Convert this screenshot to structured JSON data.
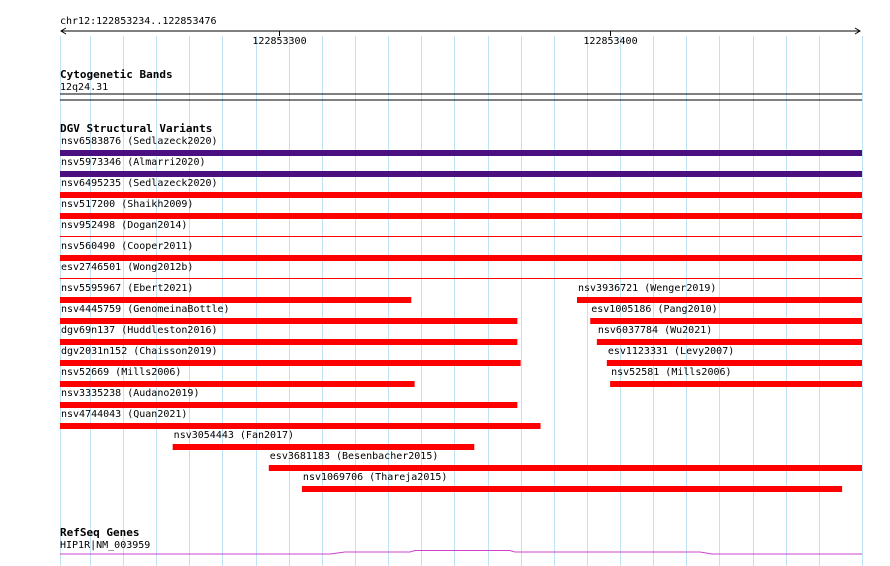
{
  "region": {
    "label": "chr12:122853234..122853476",
    "start": 122853234,
    "end": 122853476
  },
  "ruler": {
    "major_ticks": [
      {
        "pos": 122853300,
        "label": "122853300"
      },
      {
        "pos": 122853400,
        "label": "122853400"
      }
    ],
    "grid_positions": [
      122853234,
      122853243,
      122853253,
      122853263,
      122853273,
      122853283,
      122853293,
      122853303,
      122853313,
      122853323,
      122853333,
      122853343,
      122853353,
      122853363,
      122853373,
      122853383,
      122853393,
      122853403,
      122853413,
      122853423,
      122853433,
      122853443,
      122853453,
      122853463,
      122853476
    ]
  },
  "tracks": {
    "cytoband": {
      "title": "Cytogenetic Bands",
      "band": "12q24.31"
    },
    "dgv": {
      "title": "DGV Structural Variants",
      "variants": [
        {
          "label": "nsv6583876 (Sedlazeck2020)",
          "start": 122853234,
          "end": 122853476,
          "row": 0,
          "type": "inversion",
          "color": "#4b0f7f"
        },
        {
          "label": "nsv5973346 (Almarri2020)",
          "start": 122853234,
          "end": 122853476,
          "row": 1,
          "type": "inversion",
          "color": "#4b0f7f"
        },
        {
          "label": "nsv6495235 (Sedlazeck2020)",
          "start": 122853234,
          "end": 122853476,
          "row": 2,
          "type": "loss",
          "color": "#ff0000"
        },
        {
          "label": "nsv517200 (Shaikh2009)",
          "start": 122853234,
          "end": 122853476,
          "row": 3,
          "type": "loss",
          "color": "#ff0000"
        },
        {
          "label": "nsv952498 (Dogan2014)",
          "start": 122853234,
          "end": 122853476,
          "row": 4,
          "type": "loss-thin",
          "color": "#ff0000"
        },
        {
          "label": "nsv560490 (Cooper2011)",
          "start": 122853234,
          "end": 122853476,
          "row": 5,
          "type": "loss",
          "color": "#ff0000"
        },
        {
          "label": "esv2746501 (Wong2012b)",
          "start": 122853234,
          "end": 122853476,
          "row": 6,
          "type": "loss-thin",
          "color": "#ff0000"
        },
        {
          "label": "nsv5595967 (Ebert2021)",
          "start": 122853234,
          "end": 122853340,
          "row": 7,
          "type": "loss",
          "color": "#ff0000"
        },
        {
          "label": "nsv3936721 (Wenger2019)",
          "start": 122853390,
          "end": 122853476,
          "row": 7,
          "type": "loss",
          "color": "#ff0000"
        },
        {
          "label": "nsv4445759 (GenomeinaBottle)",
          "start": 122853234,
          "end": 122853372,
          "row": 8,
          "type": "loss",
          "color": "#ff0000"
        },
        {
          "label": "esv1005186 (Pang2010)",
          "start": 122853394,
          "end": 122853476,
          "row": 8,
          "type": "loss",
          "color": "#ff0000"
        },
        {
          "label": "dgv69n137 (Huddleston2016)",
          "start": 122853234,
          "end": 122853372,
          "row": 9,
          "type": "loss",
          "color": "#ff0000"
        },
        {
          "label": "nsv6037784 (Wu2021)",
          "start": 122853396,
          "end": 122853476,
          "row": 9,
          "type": "loss",
          "color": "#ff0000"
        },
        {
          "label": "dgv2031n152 (Chaisson2019)",
          "start": 122853234,
          "end": 122853373,
          "row": 10,
          "type": "loss",
          "color": "#ff0000"
        },
        {
          "label": "esv1123331 (Levy2007)",
          "start": 122853399,
          "end": 122853476,
          "row": 10,
          "type": "loss",
          "color": "#ff0000"
        },
        {
          "label": "nsv52669 (Mills2006)",
          "start": 122853234,
          "end": 122853341,
          "row": 11,
          "type": "loss",
          "color": "#ff0000"
        },
        {
          "label": "nsv52581 (Mills2006)",
          "start": 122853400,
          "end": 122853476,
          "row": 11,
          "type": "loss",
          "color": "#ff0000"
        },
        {
          "label": "nsv3335238 (Audano2019)",
          "start": 122853234,
          "end": 122853372,
          "row": 12,
          "type": "loss",
          "color": "#ff0000"
        },
        {
          "label": "nsv4744043 (Quan2021)",
          "start": 122853234,
          "end": 122853379,
          "row": 13,
          "type": "loss",
          "color": "#ff0000"
        },
        {
          "label": "nsv3054443 (Fan2017)",
          "start": 122853268,
          "end": 122853359,
          "row": 14,
          "type": "loss",
          "color": "#ff0000"
        },
        {
          "label": "esv3681183 (Besenbacher2015)",
          "start": 122853297,
          "end": 122853476,
          "row": 15,
          "type": "loss",
          "color": "#ff0000"
        },
        {
          "label": "nsv1069706 (Thareja2015)",
          "start": 122853307,
          "end": 122853470,
          "row": 16,
          "type": "loss",
          "color": "#ff0000"
        }
      ]
    },
    "refseq": {
      "title": "RefSeq Genes",
      "gene_label": "HIP1R|NM_003959",
      "color": "#cc44cc"
    }
  }
}
